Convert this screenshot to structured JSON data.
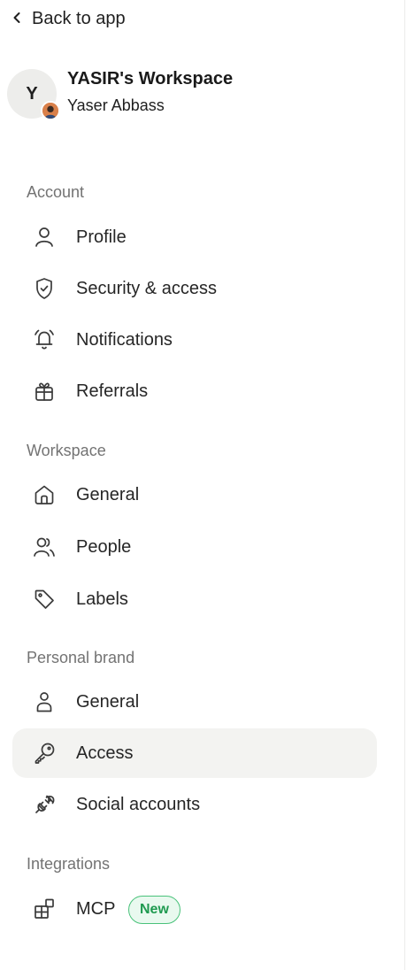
{
  "back_link": {
    "label": "Back to app",
    "icon": "chevron-left-icon"
  },
  "workspace": {
    "initial": "Y",
    "name": "YASIR's Workspace",
    "user": "Yaser Abbass"
  },
  "sections": {
    "account": {
      "title": "Account",
      "items": [
        {
          "label": "Profile",
          "icon": "user-icon"
        },
        {
          "label": "Security & access",
          "icon": "shield-check-icon"
        },
        {
          "label": "Notifications",
          "icon": "bell-icon"
        },
        {
          "label": "Referrals",
          "icon": "gift-icon"
        }
      ]
    },
    "workspace": {
      "title": "Workspace",
      "items": [
        {
          "label": "General",
          "icon": "home-icon"
        },
        {
          "label": "People",
          "icon": "users-icon"
        },
        {
          "label": "Labels",
          "icon": "tag-icon"
        }
      ]
    },
    "personal_brand": {
      "title": "Personal brand",
      "items": [
        {
          "label": "General",
          "icon": "person-icon"
        },
        {
          "label": "Access",
          "icon": "key-icon",
          "active": true
        },
        {
          "label": "Social accounts",
          "icon": "plug-icon"
        }
      ]
    },
    "integrations": {
      "title": "Integrations",
      "items": [
        {
          "label": "MCP",
          "icon": "blocks-icon",
          "badge": "New"
        }
      ]
    }
  },
  "colors": {
    "active_bg": "#f3f3f1",
    "badge_border": "#49c27a",
    "badge_text": "#1f9a50",
    "section_title": "#737373"
  }
}
